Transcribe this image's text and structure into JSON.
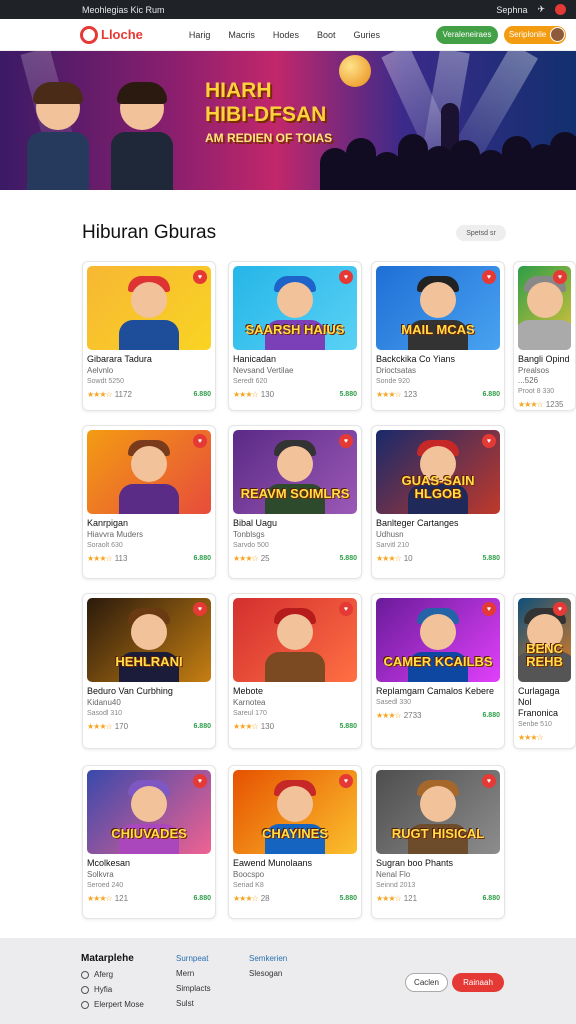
{
  "sysbar": {
    "url": "Meohlegias Kic Rum",
    "right_label": "Sephna"
  },
  "navbar": {
    "logo": "Lloche",
    "links": [
      "Harig",
      "Macris",
      "Hodes",
      "Boot",
      "Guries"
    ],
    "green_button": "Veraleneiraes",
    "orange_button": "Seriplonile"
  },
  "hero": {
    "line1": "HIARH",
    "line2": "HIBI-DFSAN",
    "line3": "AM REDIEN OF TOIAS"
  },
  "section": {
    "title": "Hiburan Gburas",
    "sort_label": "Spetsd sr"
  },
  "cards": [
    {
      "title": "Gibarara Tadura",
      "sub": "Aelvnlo",
      "meta": "Sowdt 5250",
      "rating": "1172",
      "price": "6.880",
      "theme": "yellow",
      "badge": ""
    },
    {
      "title": "Hanicadan",
      "sub": "Nevsand Vertilae",
      "meta": "Seredt 620",
      "rating": "130",
      "price": "5.880",
      "theme": "cyan",
      "badge": "SAARSH HAIUS"
    },
    {
      "title": "Backckika Co Yians",
      "sub": "Drioctsatas",
      "meta": "Sonde 920",
      "rating": "123",
      "price": "6.880",
      "theme": "blue",
      "badge": "MAIL MCAS"
    },
    {
      "title": "Bangli Opind",
      "sub": "Prealsos ...526",
      "meta": "Proot 8 330",
      "rating": "1235",
      "price": "",
      "theme": "green",
      "badge": ""
    },
    {
      "title": "Kanrpigan",
      "sub": "Hiavvra Muders",
      "meta": "Soraolt 630",
      "rating": "113",
      "price": "6.880",
      "theme": "orange",
      "badge": ""
    },
    {
      "title": "Bibal Uagu",
      "sub": "Tonblsgs",
      "meta": "Sarvdo 500",
      "rating": "25",
      "price": "5.880",
      "theme": "purple",
      "badge": "REAVM SOIMLRS"
    },
    {
      "title": "Banlteger Cartanges",
      "sub": "Udhusn",
      "meta": "Sarvitl 210",
      "rating": "10",
      "price": "5.880",
      "theme": "navy",
      "badge": "GUAS-SAIN HLGOB"
    },
    {
      "title": "Beduro Van Curbhing",
      "sub": "Kidanu40",
      "meta": "Sasodl 310",
      "rating": "170",
      "price": "6.880",
      "theme": "dark",
      "badge": "HEHLRANI"
    },
    {
      "title": "Mebote",
      "sub": "Karnotea",
      "meta": "Sareul 170",
      "rating": "130",
      "price": "5.880",
      "theme": "red",
      "badge": ""
    },
    {
      "title": "Replamgam Camalos Kebere",
      "sub": "",
      "meta": "Sasedl 330",
      "rating": "2733",
      "price": "6.880",
      "theme": "violet",
      "badge": "CAMER KCAILBS"
    },
    {
      "title": "Curlagaga Nol Franonica",
      "sub": "",
      "meta": "Senbe 510",
      "rating": "",
      "price": "",
      "theme": "teal",
      "badge": "BENC REHB"
    },
    {
      "title": "Mcolkesan",
      "sub": "Solkvra",
      "meta": "Seroed 240",
      "rating": "121",
      "price": "6.880",
      "theme": "blue2",
      "badge": "CHIUVADES"
    },
    {
      "title": "Eawend Munolaans",
      "sub": "Boocspo",
      "meta": "Seriad K8",
      "rating": "28",
      "price": "5.880",
      "theme": "amber",
      "badge": "CHAYINES"
    },
    {
      "title": "Sugran boo Phants",
      "sub": "Nenal Flo",
      "meta": "Seinnd 2013",
      "rating": "121",
      "price": "6.880",
      "theme": "gray",
      "badge": "RUGT HISICAL"
    }
  ],
  "footer": {
    "brand": "Matarplehe",
    "col1": [
      "Aferg",
      "Hyfia",
      "Elerpert Mose"
    ],
    "col2_head": "Surnpeat",
    "col2": [
      "Mern",
      "Simplacts",
      "Sulst"
    ],
    "col3_head": "Semkerien",
    "col3": [
      "Slesogan"
    ],
    "btn_outline": "Caclen",
    "btn_red": "Rainaah"
  },
  "colors": {
    "accent": "#e53935",
    "price": "#2e9d47",
    "star": "#f5a623",
    "nav_green": "#43a047",
    "nav_orange": "#f39c12"
  }
}
